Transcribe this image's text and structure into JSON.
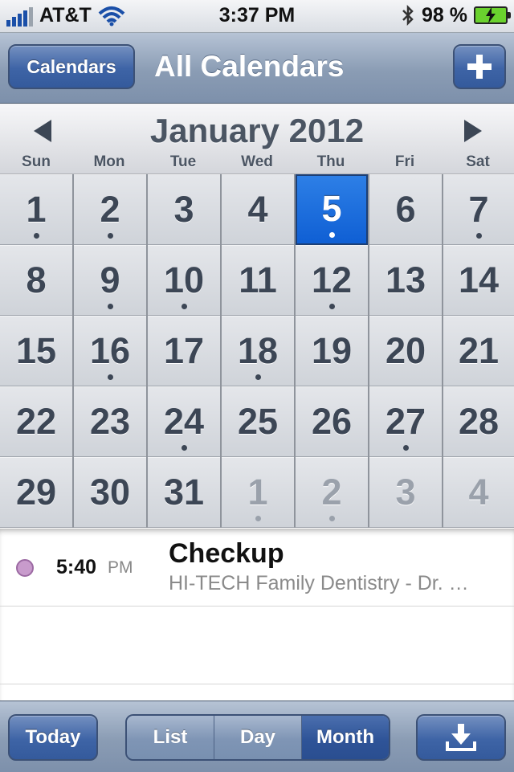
{
  "status_bar": {
    "carrier": "AT&T",
    "time": "3:37 PM",
    "battery": "98 %",
    "icons": [
      "signal-icon",
      "wifi-icon",
      "bluetooth-icon",
      "battery-icon"
    ]
  },
  "nav": {
    "left_button": "Calendars",
    "title": "All Calendars",
    "add_icon": "plus-icon"
  },
  "month": {
    "title": "January 2012",
    "weekdays": [
      "Sun",
      "Mon",
      "Tue",
      "Wed",
      "Thu",
      "Fri",
      "Sat"
    ],
    "days": [
      {
        "label": "1",
        "dot": true,
        "dim": false,
        "selected": false
      },
      {
        "label": "2",
        "dot": true,
        "dim": false,
        "selected": false
      },
      {
        "label": "3",
        "dot": false,
        "dim": false,
        "selected": false
      },
      {
        "label": "4",
        "dot": false,
        "dim": false,
        "selected": false
      },
      {
        "label": "5",
        "dot": true,
        "dim": false,
        "selected": true
      },
      {
        "label": "6",
        "dot": false,
        "dim": false,
        "selected": false
      },
      {
        "label": "7",
        "dot": true,
        "dim": false,
        "selected": false
      },
      {
        "label": "8",
        "dot": false,
        "dim": false,
        "selected": false
      },
      {
        "label": "9",
        "dot": true,
        "dim": false,
        "selected": false
      },
      {
        "label": "10",
        "dot": true,
        "dim": false,
        "selected": false
      },
      {
        "label": "11",
        "dot": false,
        "dim": false,
        "selected": false
      },
      {
        "label": "12",
        "dot": true,
        "dim": false,
        "selected": false
      },
      {
        "label": "13",
        "dot": false,
        "dim": false,
        "selected": false
      },
      {
        "label": "14",
        "dot": false,
        "dim": false,
        "selected": false
      },
      {
        "label": "15",
        "dot": false,
        "dim": false,
        "selected": false
      },
      {
        "label": "16",
        "dot": true,
        "dim": false,
        "selected": false
      },
      {
        "label": "17",
        "dot": false,
        "dim": false,
        "selected": false
      },
      {
        "label": "18",
        "dot": true,
        "dim": false,
        "selected": false
      },
      {
        "label": "19",
        "dot": false,
        "dim": false,
        "selected": false
      },
      {
        "label": "20",
        "dot": false,
        "dim": false,
        "selected": false
      },
      {
        "label": "21",
        "dot": false,
        "dim": false,
        "selected": false
      },
      {
        "label": "22",
        "dot": false,
        "dim": false,
        "selected": false
      },
      {
        "label": "23",
        "dot": false,
        "dim": false,
        "selected": false
      },
      {
        "label": "24",
        "dot": true,
        "dim": false,
        "selected": false
      },
      {
        "label": "25",
        "dot": false,
        "dim": false,
        "selected": false
      },
      {
        "label": "26",
        "dot": false,
        "dim": false,
        "selected": false
      },
      {
        "label": "27",
        "dot": true,
        "dim": false,
        "selected": false
      },
      {
        "label": "28",
        "dot": false,
        "dim": false,
        "selected": false
      },
      {
        "label": "29",
        "dot": false,
        "dim": false,
        "selected": false
      },
      {
        "label": "30",
        "dot": false,
        "dim": false,
        "selected": false
      },
      {
        "label": "31",
        "dot": false,
        "dim": false,
        "selected": false
      },
      {
        "label": "1",
        "dot": true,
        "dim": true,
        "selected": false
      },
      {
        "label": "2",
        "dot": true,
        "dim": true,
        "selected": false
      },
      {
        "label": "3",
        "dot": false,
        "dim": true,
        "selected": false
      },
      {
        "label": "4",
        "dot": false,
        "dim": true,
        "selected": false
      }
    ]
  },
  "events": [
    {
      "time": "5:40",
      "ampm": "PM",
      "title": "Checkup",
      "location": "HI-TECH Family Dentistry - Dr. Smith",
      "calendar_color": "#c89bcc"
    }
  ],
  "toolbar": {
    "today": "Today",
    "segments": [
      "List",
      "Day",
      "Month"
    ],
    "active_segment": "Month",
    "download_icon": "download-icon"
  },
  "colors": {
    "selected_day": "#1468db",
    "nav_tint": "#8a9cb4"
  }
}
